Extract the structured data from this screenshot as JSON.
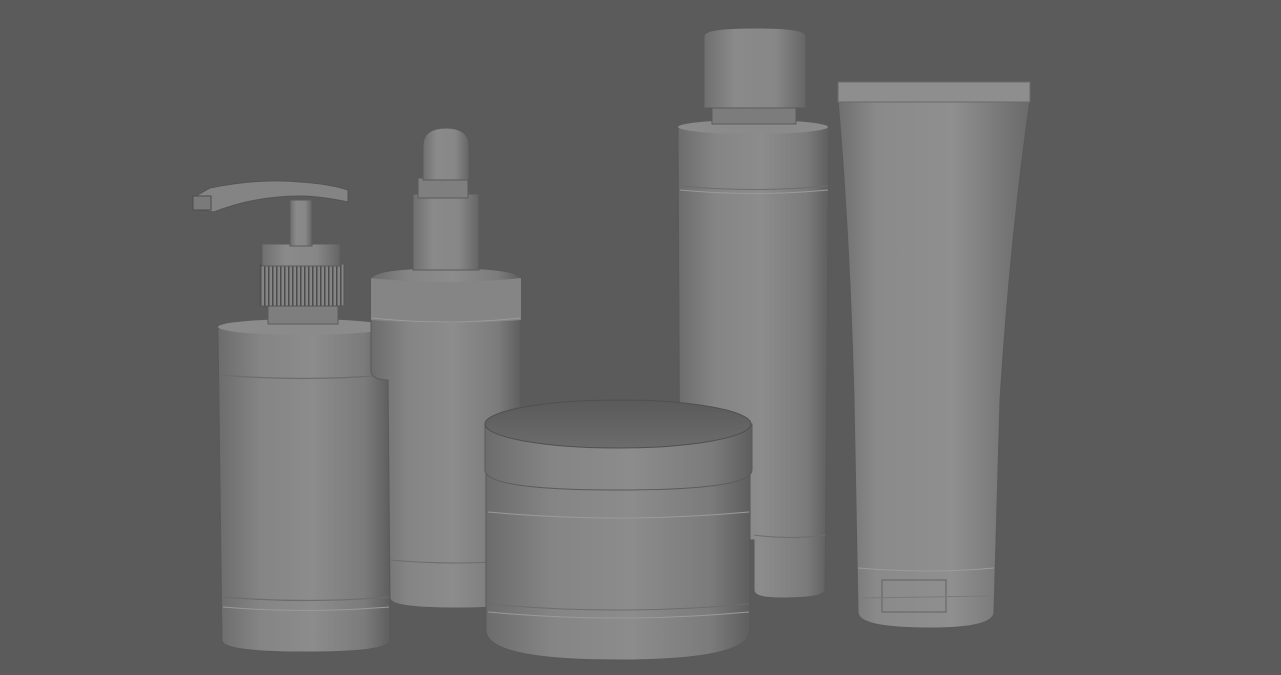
{
  "colors": {
    "background": "#5b5b5b",
    "material_light": "#8f8f8f",
    "material_mid": "#7a7a7a",
    "material_dark": "#5f5f5f",
    "edge_line": "#9b9b9b"
  }
}
